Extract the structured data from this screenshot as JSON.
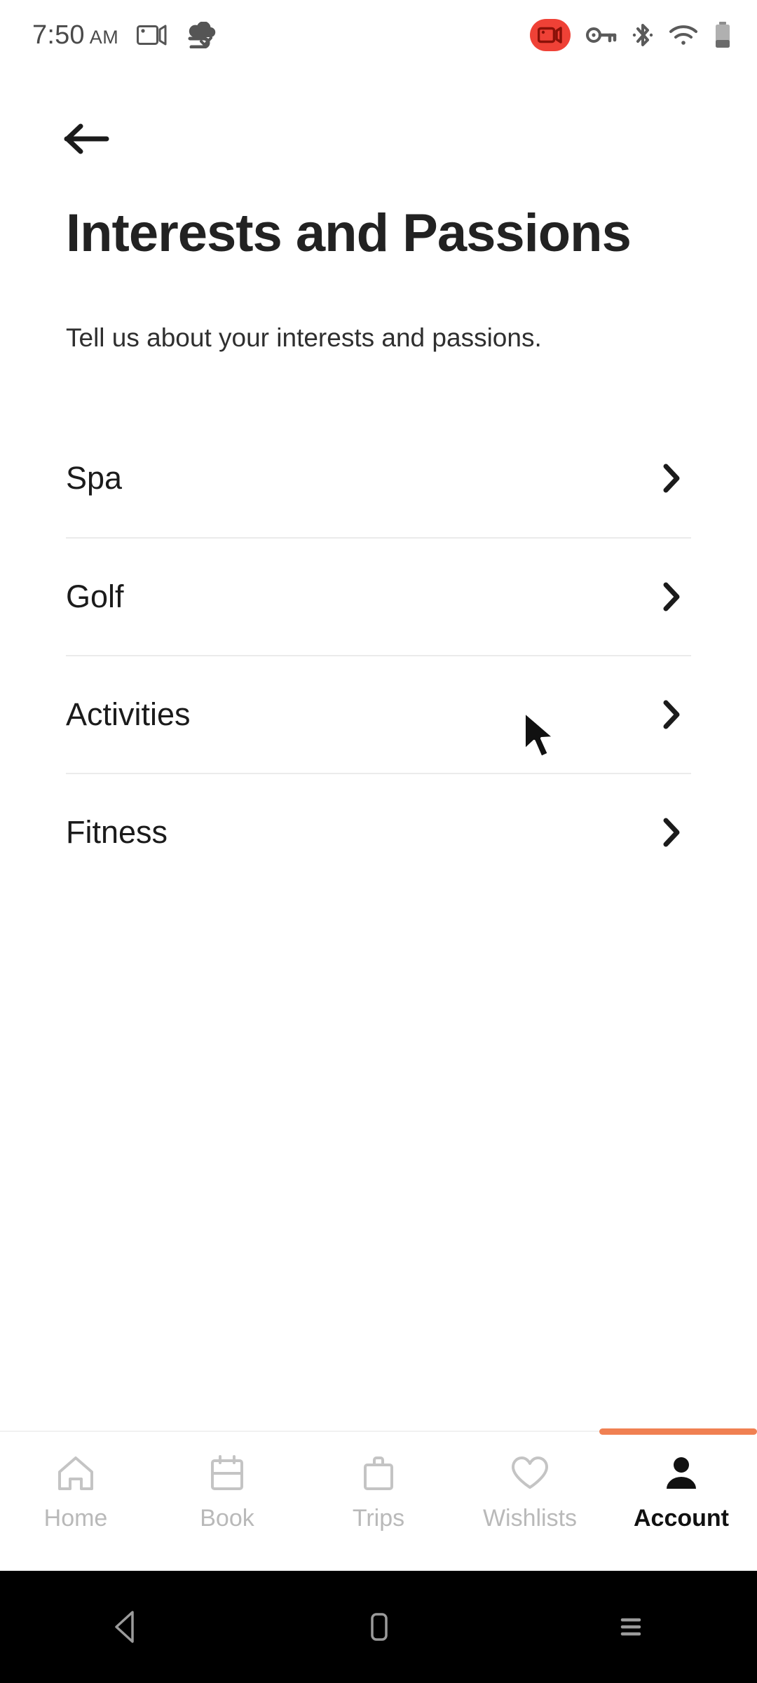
{
  "statusbar": {
    "time": "7:50",
    "ampm": "AM",
    "icons_left": [
      "screen-record-icon",
      "cloud-sync-check-icon"
    ],
    "icons_right": [
      "recording-badge-icon",
      "vpn-key-icon",
      "bluetooth-icon",
      "wifi-icon",
      "battery-icon"
    ],
    "recording_badge_color": "#ef4136"
  },
  "header": {
    "back_label": "Back",
    "title": "Interests and Passions",
    "subtitle": "Tell us about your interests and passions."
  },
  "list": {
    "items": [
      {
        "label": "Spa"
      },
      {
        "label": "Golf"
      },
      {
        "label": "Activities"
      },
      {
        "label": "Fitness"
      }
    ]
  },
  "bottom_nav": {
    "active_index": 4,
    "active_color": "#f08052",
    "inactive_color": "#b9b9b9",
    "tabs": [
      {
        "label": "Home",
        "icon": "home-icon"
      },
      {
        "label": "Book",
        "icon": "calendar-icon"
      },
      {
        "label": "Trips",
        "icon": "suitcase-icon"
      },
      {
        "label": "Wishlists",
        "icon": "heart-icon"
      },
      {
        "label": "Account",
        "icon": "person-icon"
      }
    ]
  },
  "android_nav": {
    "buttons": [
      {
        "name": "back-triangle-icon"
      },
      {
        "name": "home-square-icon"
      },
      {
        "name": "recents-menu-icon"
      }
    ]
  }
}
